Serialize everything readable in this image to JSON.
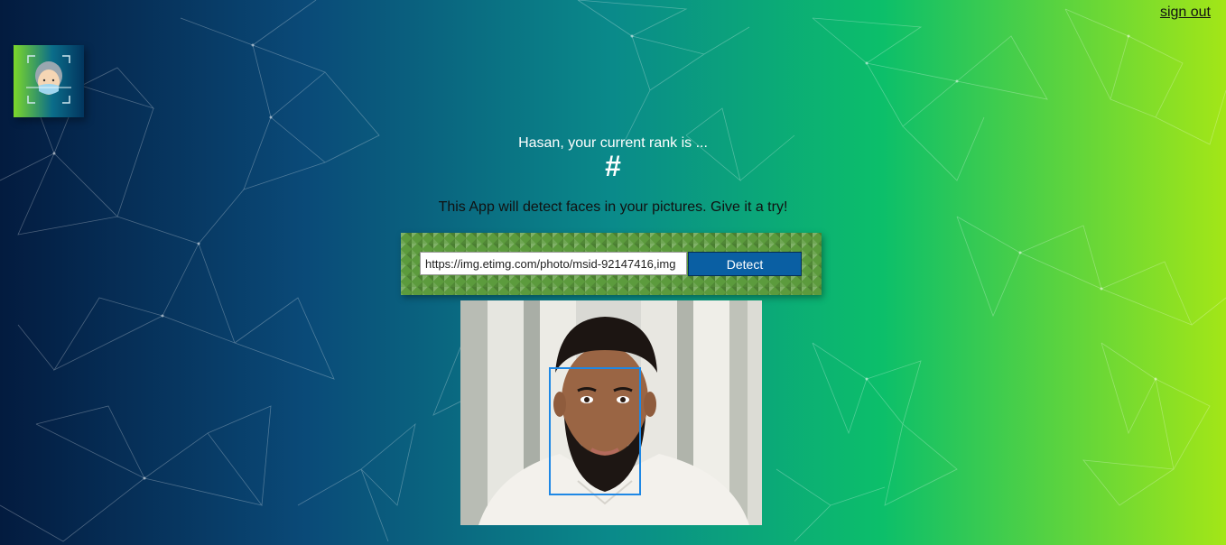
{
  "header": {
    "signout_label": "sign out"
  },
  "logo": {
    "icon": "face-scan-icon"
  },
  "rank": {
    "message": "Hasan, your current rank is ...",
    "value": "#"
  },
  "intro": {
    "text": "This App will detect faces in your pictures. Give it a try!"
  },
  "form": {
    "input_value": "https://img.etimg.com/photo/msid-92147416,img",
    "detect_label": "Detect"
  },
  "result": {
    "image": "detected-face-photo",
    "face_box_color": "#1e88e5"
  }
}
